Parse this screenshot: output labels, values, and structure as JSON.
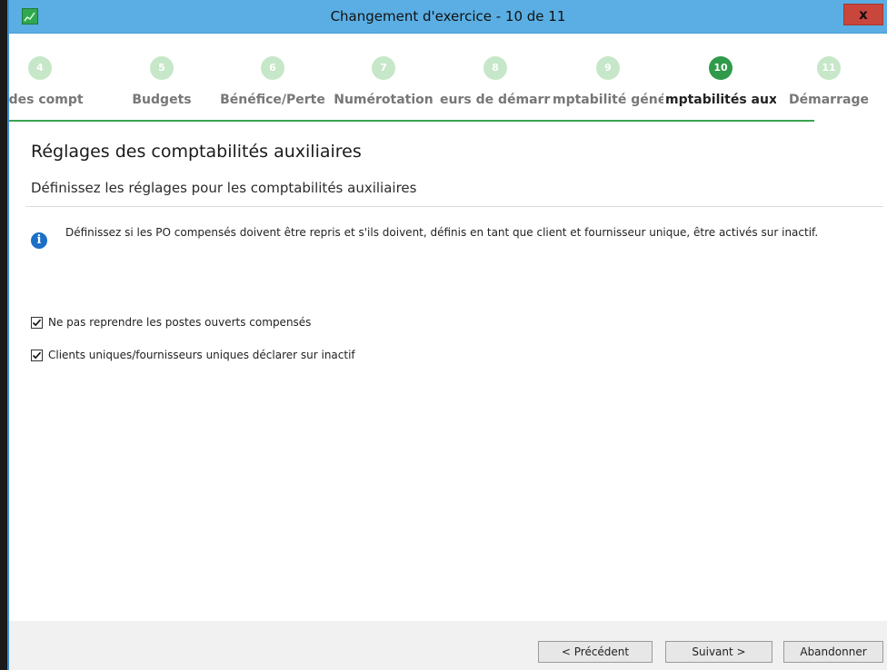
{
  "window": {
    "title": "Changement d'exercice - 10 de 11",
    "close_label": "x"
  },
  "steps": [
    {
      "num": "4",
      "label": "s des compt",
      "active": false
    },
    {
      "num": "5",
      "label": "Budgets",
      "active": false
    },
    {
      "num": "6",
      "label": "Bénéfice/Perte",
      "active": false
    },
    {
      "num": "7",
      "label": "Numérotation",
      "active": false
    },
    {
      "num": "8",
      "label": "eurs de démarra",
      "active": false
    },
    {
      "num": "9",
      "label": "mptabilité génér",
      "active": false
    },
    {
      "num": "10",
      "label": "mptabilités auxilia",
      "active": true
    },
    {
      "num": "11",
      "label": "Démarrage",
      "active": false
    }
  ],
  "page": {
    "title": "Réglages des comptabilités auxiliaires",
    "subtitle": "Définissez les réglages pour les comptabilités auxiliaires",
    "info_text": "Définissez si les PO compensés doivent être repris et s'ils doivent, définis en tant que client et fournisseur unique, être activés sur inactif."
  },
  "options": [
    {
      "label": "Ne pas reprendre les postes ouverts compensés",
      "checked": true
    },
    {
      "label": "Clients uniques/fournisseurs uniques déclarer sur inactif",
      "checked": true
    }
  ],
  "footer": {
    "prev_label": "< Précédent",
    "next_label": "Suivant >",
    "cancel_label": "Abandonner"
  }
}
